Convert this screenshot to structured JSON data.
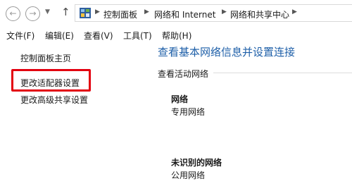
{
  "breadcrumb": {
    "items": [
      "控制面板",
      "网络和 Internet",
      "网络和共享中心"
    ]
  },
  "menu": [
    "文件(F)",
    "编辑(E)",
    "查看(V)",
    "工具(T)",
    "帮助(H)"
  ],
  "sidebar": {
    "links": [
      "控制面板主页",
      "更改适配器设置",
      "更改高级共享设置"
    ]
  },
  "main": {
    "title": "查看基本网络信息并设置连接",
    "active_networks_label": "查看活动网络",
    "networks": [
      {
        "name": "网络",
        "type": "专用网络"
      },
      {
        "name": "未识别的网络",
        "type": "公用网络"
      }
    ]
  },
  "colors": {
    "title": "#1e5fa8",
    "highlight": "#e3000f"
  }
}
